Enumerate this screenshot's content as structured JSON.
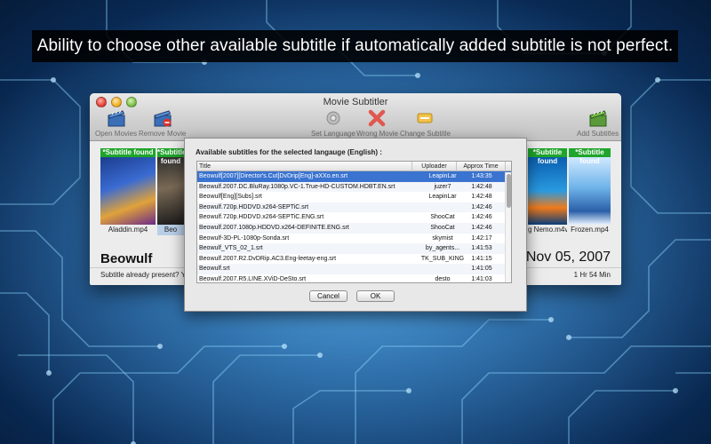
{
  "caption": "Ability to choose other available subtitle if automatically added subtitle is not perfect.",
  "window": {
    "title": "Movie Subtitler",
    "toolbar": {
      "open_movies": "Open Movies",
      "remove_movie": "Remove Movie",
      "set_language": "Set Language",
      "wrong_movie": "Wrong Movie",
      "change_subtitle": "Change Subtitle",
      "add_subtitles": "Add Subtitles"
    },
    "movies": [
      {
        "badge": "*Subtitle found",
        "file": "Aladdin.mp4"
      },
      {
        "badge": "*Subtitle found",
        "file": "Beo"
      },
      {
        "badge": "*Subtitle found",
        "file": "g Nemo.m4v"
      },
      {
        "badge": "*Subtitle found",
        "file": "Frozen.mp4"
      }
    ],
    "selected_movie": {
      "title": "Beowulf",
      "release_date": "Nov 05, 2007",
      "subtitle_present": "Subtitle already present? YES",
      "duration": "1 Hr 54 Min"
    }
  },
  "sheet": {
    "label": "Available subtitles for the selected langauge (English) :",
    "columns": {
      "title": "Title",
      "uploader": "Uploader",
      "time": "Approx Time"
    },
    "rows": [
      {
        "title": "Beowulf[2007][Director's.Cut]DvDrip[Eng]-aXXo.en.srt",
        "uploader": "LeapinLar",
        "time": "1:43:35"
      },
      {
        "title": "Beowulf.2007.DC.BluRay.1080p.VC-1.True-HD-CUSTOM.HDBT.EN.srt",
        "uploader": "juzer7",
        "time": "1:42:48"
      },
      {
        "title": "Beowulf[Eng][Subs].srt",
        "uploader": "LeapinLar",
        "time": "1:42:48"
      },
      {
        "title": "Beowulf.720p.HDDVD.x264-SEPTiC.srt",
        "uploader": "",
        "time": "1:42:46"
      },
      {
        "title": "Beowulf.720p.HDDVD.x264-SEPTiC.ENG.srt",
        "uploader": "ShooCat",
        "time": "1:42:46"
      },
      {
        "title": "Beowulf.2007.1080p.HDDVD.x264-DEFINITE.ENG.srt",
        "uploader": "ShooCat",
        "time": "1:42:46"
      },
      {
        "title": "Beowulf-3D-PL-1080p-Sonda.srt",
        "uploader": "skymist",
        "time": "1:42:17"
      },
      {
        "title": "Beowulf_VTS_02_1.srt",
        "uploader": "by_agents...",
        "time": "1:41:53"
      },
      {
        "title": "Beowulf.2007.R2.DvDRip.AC3.Eng-leetay-eng.srt",
        "uploader": "TK_SUB_KING",
        "time": "1:41:15"
      },
      {
        "title": "Beowulf.srt",
        "uploader": "",
        "time": "1:41:05"
      },
      {
        "title": "Beowulf.2007.R5.LINE.XViD-DeSto.srt",
        "uploader": "desto",
        "time": "1:41:03"
      }
    ],
    "cancel": "Cancel",
    "ok": "OK"
  },
  "colors": {
    "selection": "#3a73d0",
    "badge": "#1fa52b"
  }
}
